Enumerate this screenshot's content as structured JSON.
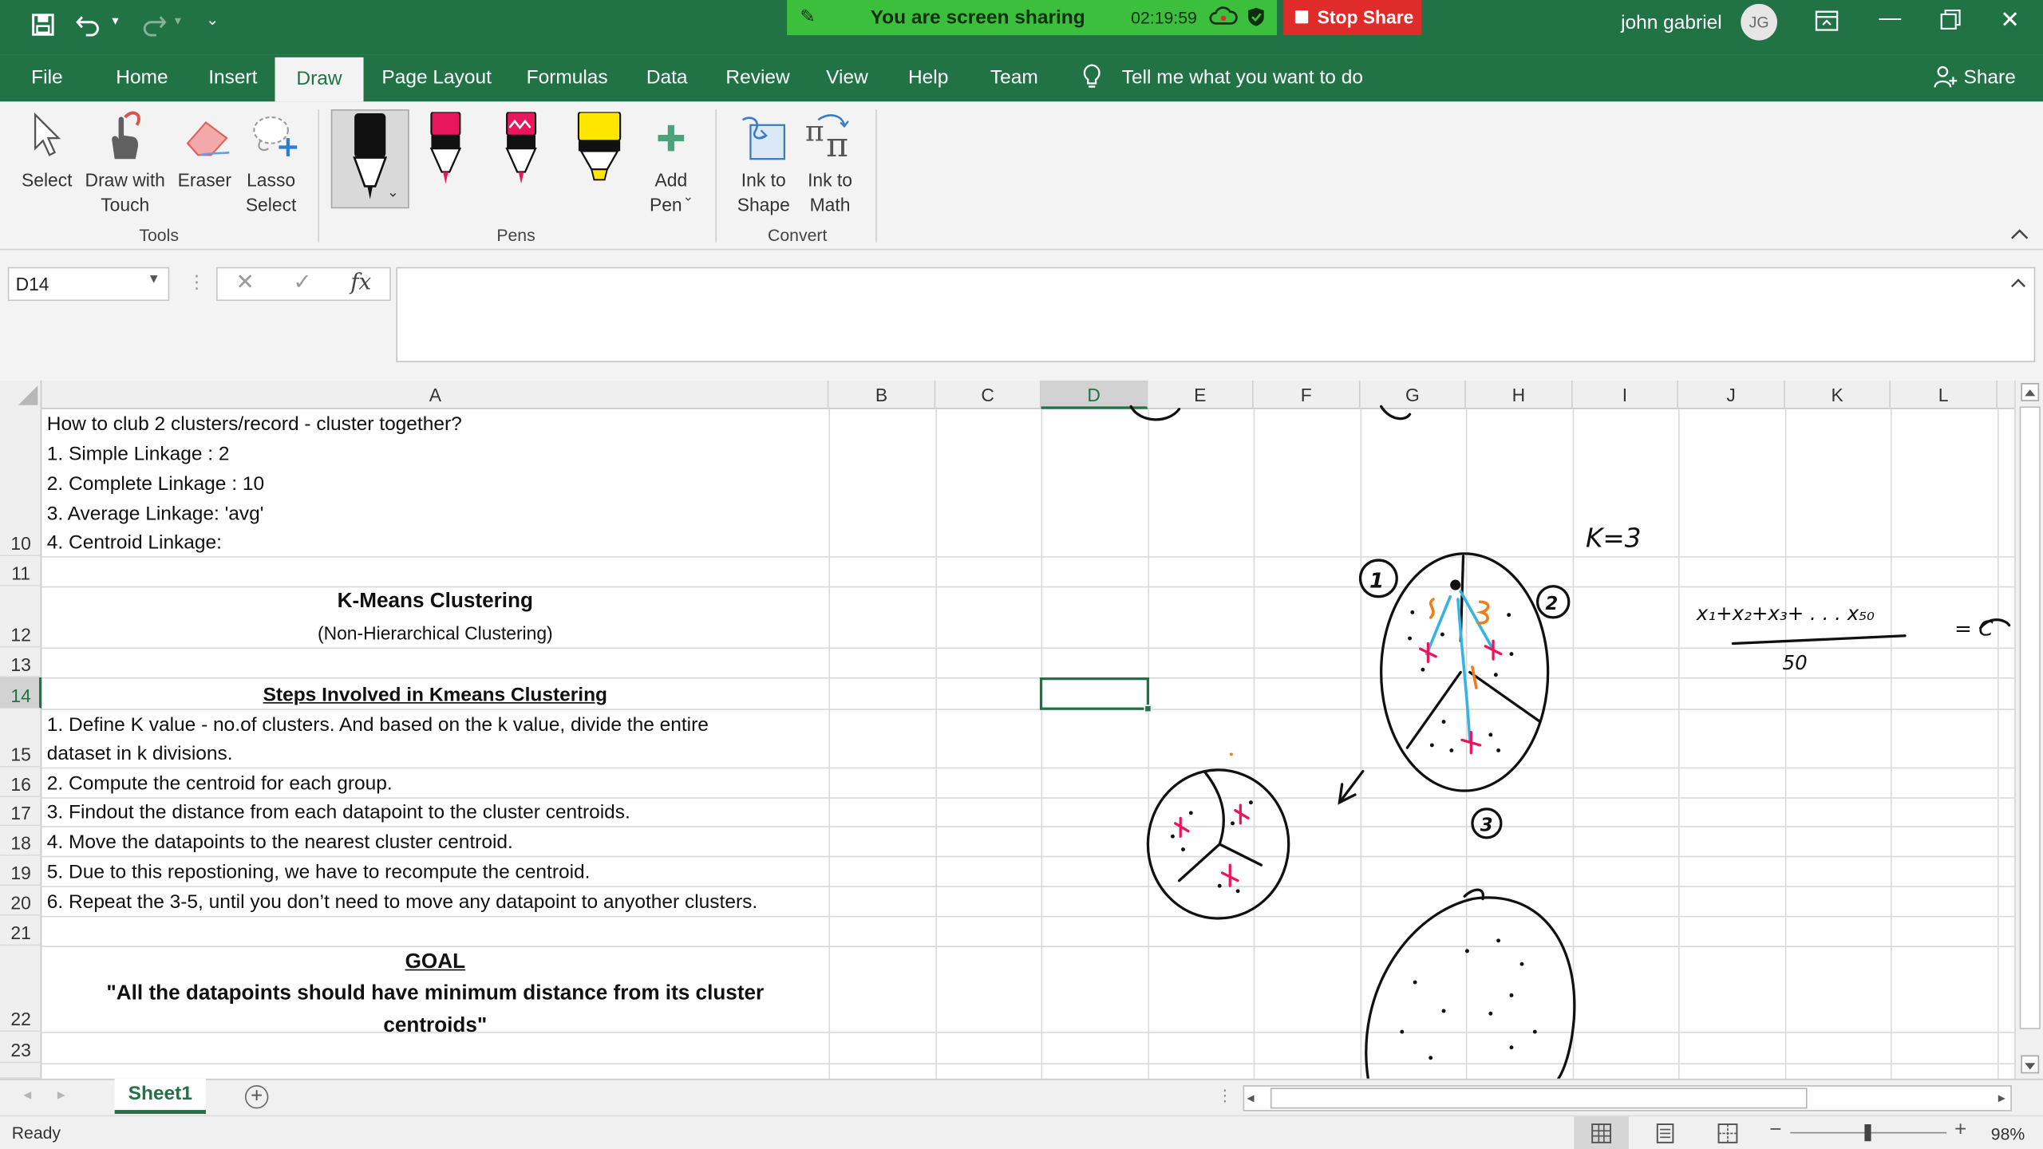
{
  "titlebar": {
    "banner_text": "You are screen sharing",
    "timer": "02:19:59",
    "stop_share": "Stop Share",
    "user_name": "john gabriel",
    "user_initials": "JG"
  },
  "tabs": [
    "File",
    "Home",
    "Insert",
    "Draw",
    "Page Layout",
    "Formulas",
    "Data",
    "Review",
    "View",
    "Help",
    "Team"
  ],
  "tell_me": "Tell me what you want to do",
  "share_label": "Share",
  "ribbon": {
    "tools": {
      "select": "Select",
      "draw_touch_1": "Draw with",
      "draw_touch_2": "Touch",
      "eraser": "Eraser",
      "lasso_1": "Lasso",
      "lasso_2": "Select",
      "group": "Tools"
    },
    "pens": {
      "add_pen_1": "Add",
      "add_pen_2": "Pen",
      "group": "Pens"
    },
    "convert": {
      "ink_shape_1": "Ink to",
      "ink_shape_2": "Shape",
      "ink_math_1": "Ink to",
      "ink_math_2": "Math",
      "group": "Convert"
    },
    "colors": {
      "ribbon_green": "#217346",
      "pen_black": "#111111",
      "pen_pink": "#e8175d",
      "highlighter_yellow": "#ffe600"
    }
  },
  "formula_bar": {
    "name_box": "D14",
    "fx": "fx",
    "value": ""
  },
  "columns": [
    "A",
    "B",
    "C",
    "D",
    "E",
    "F",
    "G",
    "H",
    "I",
    "J",
    "K",
    "L"
  ],
  "rows": [
    "",
    "",
    "",
    "",
    "10",
    "11",
    "12",
    "13",
    "14",
    "15",
    "16",
    "17",
    "18",
    "19",
    "20",
    "21",
    "22",
    "23"
  ],
  "cells": {
    "a_line1": "How to club 2 clusters/record - cluster together?",
    "a_line2": "1. Simple Linkage : 2",
    "a_line3": "2. Complete Linkage : 10",
    "a_line4": "3. Average Linkage: 'avg'",
    "a10": "4. Centroid Linkage:",
    "a12_title": "K-Means Clustering",
    "a12_sub": "(Non-Hierarchical Clustering)",
    "a14": "Steps Involved in Kmeans Clustering",
    "a15_line1": "1. Define K value - no.of clusters. And based on the k value, divide the entire",
    "a15_line2": "dataset in k divisions.",
    "a16": "2. Compute the centroid for each group.",
    "a17": "3. Findout the distance from each datapoint to the cluster centroids.",
    "a18": "4. Move the datapoints to the nearest cluster centroid.",
    "a19": "5. Due to this repostioning, we have to recompute the centroid.",
    "a20": "6. Repeat the 3-5, until you don’t need to move any datapoint to anyother clusters.",
    "a22_title": "GOAL",
    "a22_line1": "\"All the datapoints should have minimum distance from its cluster",
    "a22_line2": "centroids\""
  },
  "ink_labels": {
    "k_equals": "K=3",
    "formula_numerator": "x₁+x₂+x₃+ . . . x₅₀",
    "formula_denominator": "50",
    "formula_rhs": "= C",
    "cluster_1": "1",
    "cluster_2": "2",
    "cluster_3": "3"
  },
  "sheet_tab": "Sheet1",
  "status": {
    "ready": "Ready",
    "zoom": "98%"
  }
}
